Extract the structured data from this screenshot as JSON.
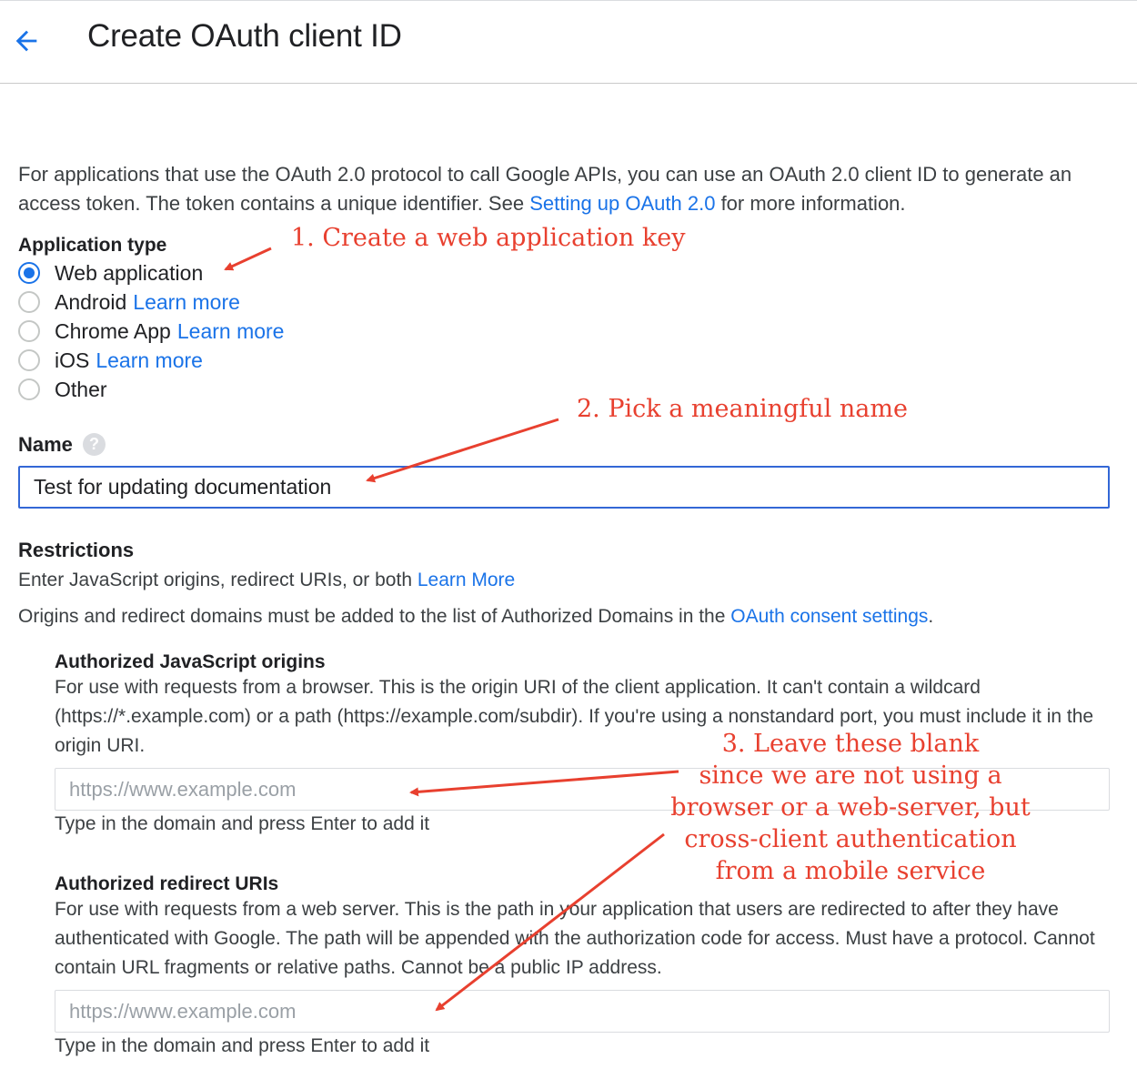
{
  "header": {
    "back_icon": "arrow-back-icon",
    "title": "Create OAuth client ID"
  },
  "intro": {
    "text_before": "For applications that use the OAuth 2.0 protocol to call Google APIs, you can use an OAuth 2.0 client ID to generate an access token. The token contains a unique identifier. See ",
    "link": "Setting up OAuth 2.0",
    "text_after": " for more information."
  },
  "application_type": {
    "label": "Application type",
    "options": [
      {
        "label": "Web application",
        "link": "",
        "selected": true
      },
      {
        "label": "Android",
        "link": "Learn more",
        "selected": false
      },
      {
        "label": "Chrome App",
        "link": "Learn more",
        "selected": false
      },
      {
        "label": "iOS",
        "link": "Learn more",
        "selected": false
      },
      {
        "label": "Other",
        "link": "",
        "selected": false
      }
    ]
  },
  "name": {
    "label": "Name",
    "help_icon": "help-icon",
    "help_glyph": "?",
    "value": "Test for updating documentation"
  },
  "restrictions": {
    "title": "Restrictions",
    "line1_text": "Enter JavaScript origins, redirect URIs, or both ",
    "line1_link": "Learn More",
    "line2_text": "Origins and redirect domains must be added to the list of Authorized Domains in the ",
    "line2_link": "OAuth consent settings",
    "line2_end": "."
  },
  "js_origins": {
    "title": "Authorized JavaScript origins",
    "description": "For use with requests from a browser. This is the origin URI of the client application. It can't contain a wildcard (https://*.example.com) or a path (https://example.com/subdir). If you're using a nonstandard port, you must include it in the origin URI.",
    "placeholder": "https://www.example.com",
    "hint": "Type in the domain and press Enter to add it"
  },
  "redirect_uris": {
    "title": "Authorized redirect URIs",
    "description": "For use with requests from a web server. This is the path in your application that users are redirected to after they have authenticated with Google. The path will be appended with the authorization code for access. Must have a protocol. Cannot contain URL fragments or relative paths. Cannot be a public IP address.",
    "placeholder": "https://www.example.com",
    "hint": "Type in the domain and press Enter to add it"
  },
  "annotations": {
    "a1": "1. Create a web application key",
    "a2": "2. Pick a meaningful name",
    "a3": [
      "3. Leave these blank",
      "since we are not using a",
      "browser or a web-server, but",
      "cross-client authentication",
      "from a mobile service"
    ],
    "color": "#e8402f"
  },
  "colors": {
    "link": "#1a73e8",
    "input_focus_border": "#3367d6",
    "radio_selected": "#1a73e8",
    "annotation": "#e8402f"
  }
}
